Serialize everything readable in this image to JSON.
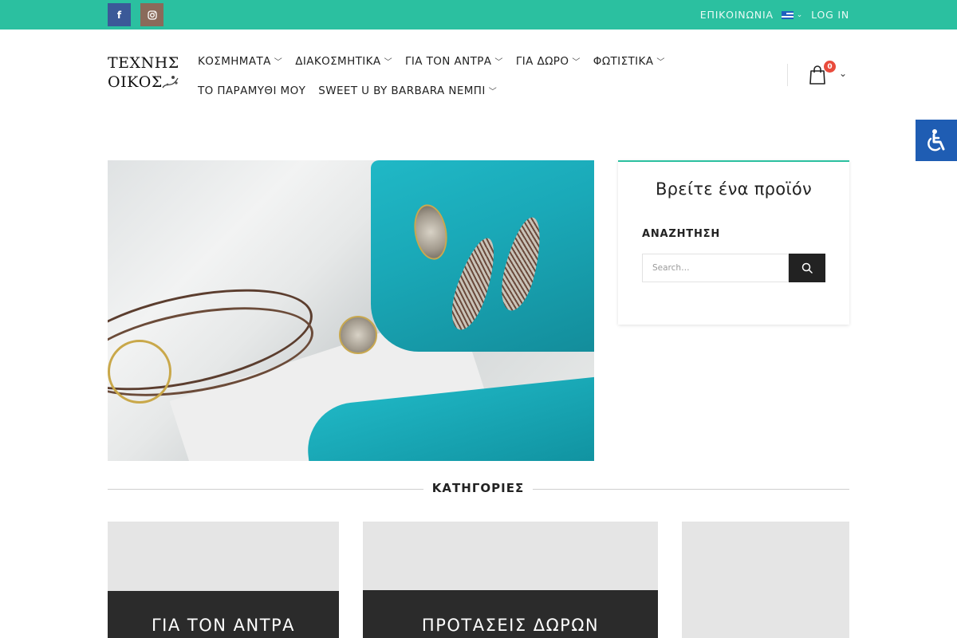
{
  "topbar": {
    "social": [
      {
        "name": "facebook",
        "glyph": "f"
      },
      {
        "name": "instagram",
        "glyph": "◎"
      }
    ],
    "contact_label": "ΕΠΙΚΟΙΝΩΝΙΑ",
    "language_flag": "greek-flag-icon",
    "login_label": "LOG IN",
    "bar_color": "#2bc0a0"
  },
  "logo": {
    "line1": "ΤΕΧΝΗΣ",
    "line2": "ΟΙΚΟΣ"
  },
  "nav": {
    "row1": [
      {
        "label": "ΚΟΣΜΗΜΑΤΑ"
      },
      {
        "label": "ΔΙΑΚΟΣΜΗΤΙΚΑ"
      },
      {
        "label": "ΓΙΑ ΤΟΝ ΑΝΤΡΑ"
      },
      {
        "label": "ΓΙΑ ΔΩΡΟ"
      },
      {
        "label": "ΦΩΤΙΣΤΙΚΑ"
      }
    ],
    "row2": [
      {
        "label": "ΤΟ ΠΑΡΑΜΥΘΙ ΜΟΥ"
      },
      {
        "label": "SWEET U BY BARBARA ΝΕΜΠΙ"
      }
    ]
  },
  "cart": {
    "count": "0",
    "badge_color": "#e94b3c"
  },
  "widget": {
    "title": "Βρείτε ένα προϊόν",
    "subtitle": "ΑΝΑΖΗΤΗΣΗ",
    "search_placeholder": "Search…"
  },
  "categories": {
    "heading": "ΚΑΤΗΓΟΡΙΕΣ",
    "cards": [
      {
        "label": "ΓΙΑ ΤΟΝ ΑΝΤΡΑ"
      },
      {
        "label": "ΠΡΟΤΑΣΕΙΣ ΔΩΡΩΝ"
      },
      {
        "label": ""
      }
    ]
  }
}
